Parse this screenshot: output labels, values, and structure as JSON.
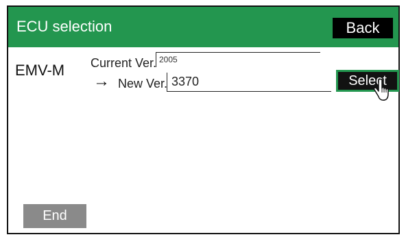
{
  "header": {
    "title": "ECU selection",
    "back_label": "Back"
  },
  "ecu": {
    "name": "EMV-M",
    "current_label": "Current Ver.",
    "current_value": "2005",
    "new_label": "New Ver.",
    "new_value": "3370",
    "arrow": "→"
  },
  "actions": {
    "select_label": "Select",
    "end_label": "End"
  },
  "icons": {
    "pointer": "hand-pointer-icon"
  },
  "colors": {
    "header_bg": "#23964f",
    "select_border": "#23964f",
    "end_bg": "#8a8a8a"
  }
}
